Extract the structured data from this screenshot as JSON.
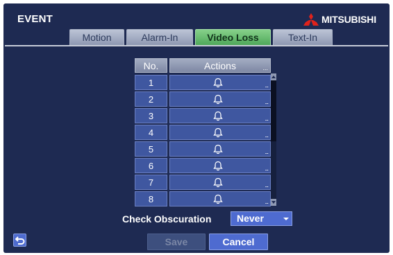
{
  "window": {
    "title": "EVENT",
    "brand": "MITSUBISHI"
  },
  "tabs": [
    {
      "label": "Motion",
      "active": false
    },
    {
      "label": "Alarm-In",
      "active": false
    },
    {
      "label": "Video Loss",
      "active": true
    },
    {
      "label": "Text-In",
      "active": false
    }
  ],
  "table": {
    "headers": {
      "no": "No.",
      "actions": "Actions"
    },
    "header_more": "...",
    "rows": [
      {
        "no": "1",
        "more": "..."
      },
      {
        "no": "2",
        "more": "..."
      },
      {
        "no": "3",
        "more": "..."
      },
      {
        "no": "4",
        "more": "..."
      },
      {
        "no": "5",
        "more": "..."
      },
      {
        "no": "6",
        "more": "..."
      },
      {
        "no": "7",
        "more": "..."
      },
      {
        "no": "8",
        "more": "..."
      }
    ],
    "action_icon": "bell-icon"
  },
  "check_obscuration": {
    "label": "Check Obscuration",
    "value": "Never"
  },
  "buttons": {
    "save": "Save",
    "cancel": "Cancel",
    "save_enabled": false
  },
  "colors": {
    "background": "#1e2a52",
    "active_tab": "#5cb85c",
    "brand_red": "#e0221b",
    "accent": "#4e6bd0"
  }
}
